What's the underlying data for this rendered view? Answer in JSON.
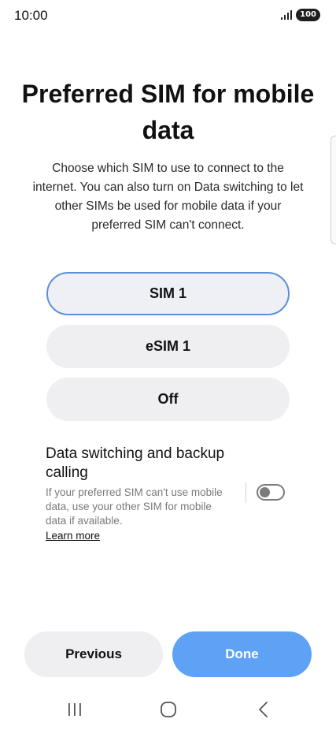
{
  "status_bar": {
    "time": "10:00",
    "battery": "100",
    "signal_icon": "signal-icon"
  },
  "page": {
    "title": "Preferred SIM for mobile data",
    "description": "Choose which SIM to use to connect to the internet. You can also turn on Data switching to let other SIMs be used for mobile data if your preferred SIM can't connect."
  },
  "options": [
    {
      "label": "SIM 1",
      "selected": true
    },
    {
      "label": "eSIM 1",
      "selected": false
    },
    {
      "label": "Off",
      "selected": false
    }
  ],
  "data_switching": {
    "title": "Data switching and backup calling",
    "description": "If your preferred SIM can't use mobile data, use your other SIM for mobile data if available.",
    "link": "Learn more",
    "enabled": false
  },
  "buttons": {
    "previous": "Previous",
    "done": "Done"
  },
  "colors": {
    "accent": "#5ea2f6",
    "selected_border": "#5d8fd6",
    "option_bg": "#efeff1"
  },
  "nav": {
    "icons": [
      "recents-icon",
      "home-icon",
      "back-icon"
    ]
  }
}
